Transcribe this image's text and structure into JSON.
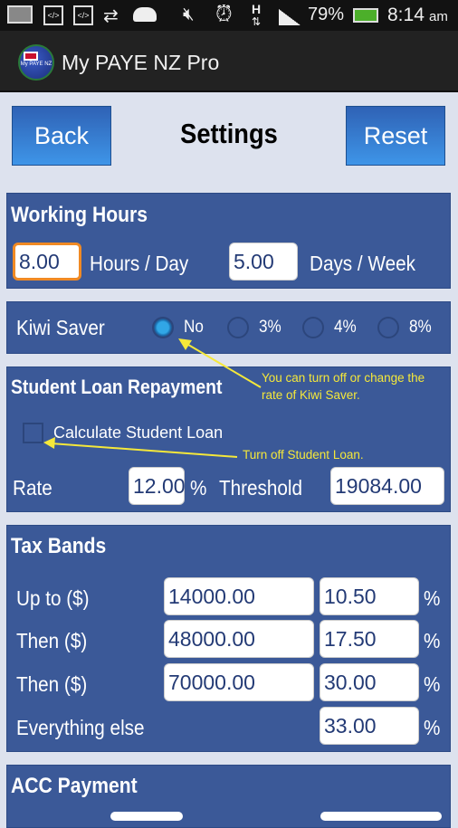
{
  "status_bar": {
    "battery": "79%",
    "time": "8:14",
    "ampm": "am"
  },
  "app": {
    "title": "My PAYE NZ Pro",
    "logo_text": "My PAYE NZ"
  },
  "header": {
    "back": "Back",
    "title": "Settings",
    "reset": "Reset"
  },
  "working_hours": {
    "title": "Working Hours",
    "hours_value": "8.00",
    "hours_label": "Hours / Day",
    "days_value": "5.00",
    "days_label": "Days / Week"
  },
  "kiwi_saver": {
    "label": "Kiwi Saver",
    "options": [
      "No",
      "3%",
      "4%",
      "8%"
    ],
    "selected": "No"
  },
  "student_loan": {
    "title": "Student Loan Repayment",
    "checkbox_label": "Calculate Student Loan",
    "checked": false,
    "rate_label": "Rate",
    "rate_value": "12.00",
    "percent": "%",
    "threshold_label": "Threshold",
    "threshold_value": "19084.00"
  },
  "annotations": {
    "kiwi_line1": "You can turn off or change the",
    "kiwi_line2": "rate of Kiwi Saver.",
    "loan": "Turn off Student Loan.",
    "color": "#f5e83a"
  },
  "tax_bands": {
    "title": "Tax Bands",
    "rows": [
      {
        "label": "Up to ($)",
        "amount": "14000.00",
        "rate": "10.50",
        "unit": "%"
      },
      {
        "label": "Then ($)",
        "amount": "48000.00",
        "rate": "17.50",
        "unit": "%"
      },
      {
        "label": "Then ($)",
        "amount": "70000.00",
        "rate": "30.00",
        "unit": "%"
      },
      {
        "label": "Everything else",
        "rate": "33.00",
        "unit": "%"
      }
    ]
  },
  "acc": {
    "title": "ACC Payment"
  },
  "colors": {
    "panel": "#3b5998",
    "background": "#dde2ee",
    "button": "#3e95e8",
    "focus": "#f08a24"
  }
}
